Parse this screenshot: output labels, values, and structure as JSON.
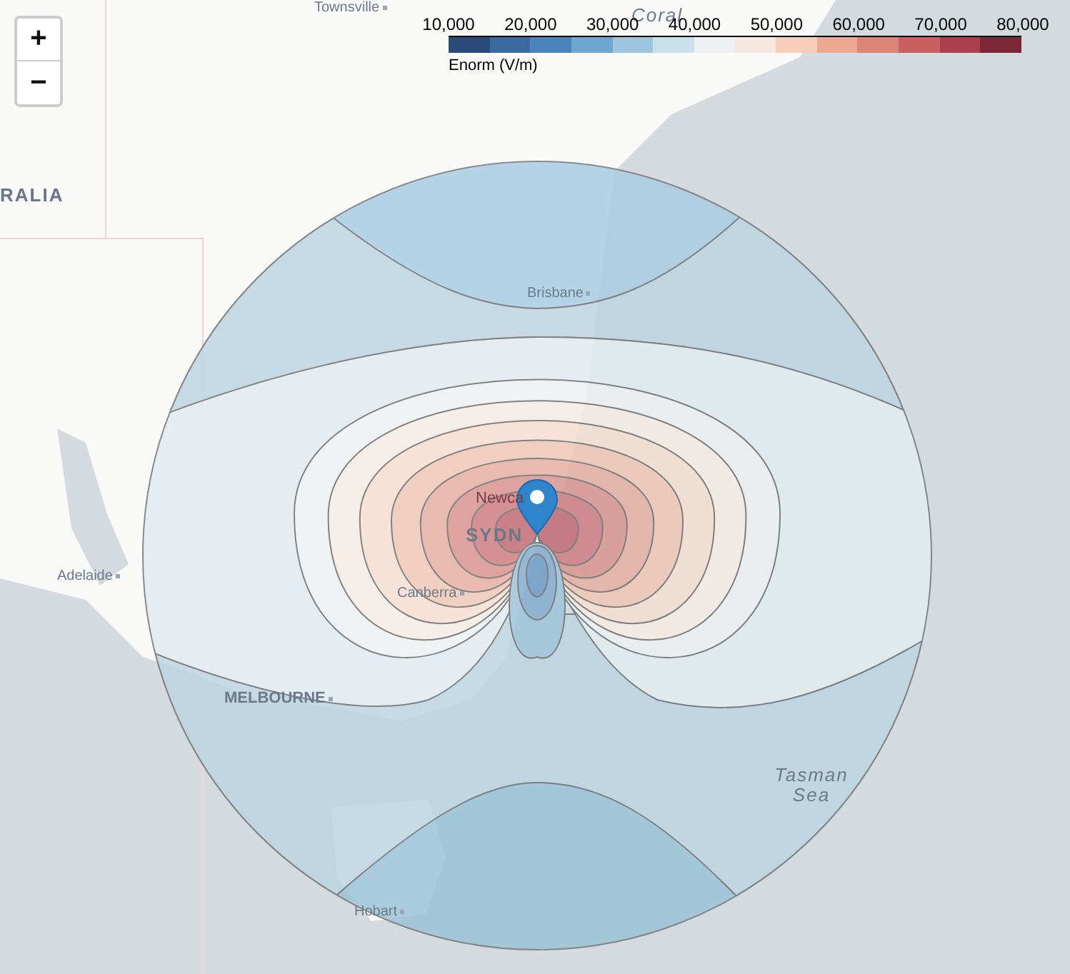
{
  "zoom_controls": [
    {
      "label": "+"
    },
    {
      "label": "−"
    }
  ],
  "legend": {
    "ticks": [
      "10,000",
      "20,000",
      "30,000",
      "40,000",
      "50,000",
      "60,000",
      "70,000",
      "80,000"
    ],
    "title": "Enorm (V/m)"
  },
  "map_labels": [
    {
      "text": "Townsville",
      "kind": "city"
    },
    {
      "text": "Coral",
      "kind": "sea"
    },
    {
      "text": "RALIA",
      "kind": "region"
    },
    {
      "text": "Brisbane",
      "kind": "city"
    },
    {
      "text": "Newca",
      "kind": "plain"
    },
    {
      "text": "SYDN",
      "kind": "region"
    },
    {
      "text": "Canberra",
      "kind": "city"
    },
    {
      "text": "Adelaide",
      "kind": "city"
    },
    {
      "text": "MELBOURNE",
      "kind": "capital"
    },
    {
      "text": "Tasman Sea",
      "kind": "sea"
    },
    {
      "text": "Hobart",
      "kind": "city"
    }
  ]
}
